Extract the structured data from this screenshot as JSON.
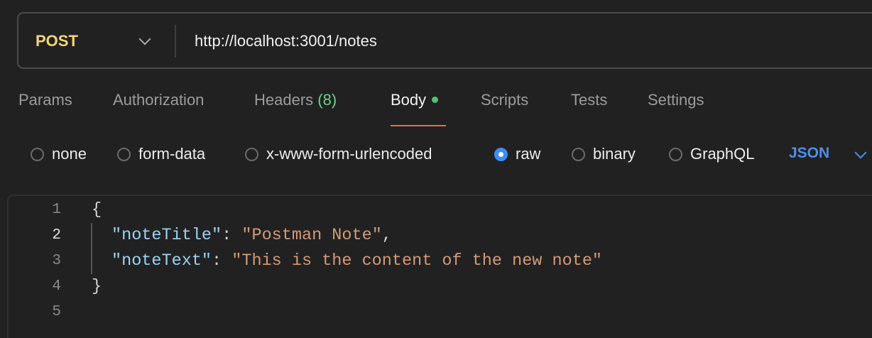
{
  "request": {
    "method": "POST",
    "url": "http://localhost:3001/notes"
  },
  "tabs": [
    {
      "label": "Params"
    },
    {
      "label": "Authorization"
    },
    {
      "label": "Headers",
      "count": "(8)"
    },
    {
      "label": "Body",
      "active": true
    },
    {
      "label": "Scripts"
    },
    {
      "label": "Tests"
    },
    {
      "label": "Settings"
    }
  ],
  "body_types": [
    {
      "label": "none",
      "selected": false
    },
    {
      "label": "form-data",
      "selected": false
    },
    {
      "label": "x-www-form-urlencoded",
      "selected": false
    },
    {
      "label": "raw",
      "selected": true
    },
    {
      "label": "binary",
      "selected": false
    },
    {
      "label": "GraphQL",
      "selected": false
    }
  ],
  "format": "JSON",
  "editor": {
    "line_numbers": [
      "1",
      "2",
      "3",
      "4",
      "5"
    ],
    "lines": [
      {
        "open": "{"
      },
      {
        "key": "\"noteTitle\"",
        "sep": ": ",
        "value": "\"Postman Note\"",
        "end": ","
      },
      {
        "key": "\"noteText\"",
        "sep": ": ",
        "value": "\"This is the content of the new note\"",
        "end": ""
      },
      {
        "open": "}"
      }
    ]
  },
  "colors": {
    "method": "#f2d57a",
    "active_tab_underline": "#f26b3a",
    "radio_selected": "#3d8df5",
    "json_key": "#9cd2f5",
    "json_string": "#d39a78",
    "format": "#4e8fe8"
  }
}
